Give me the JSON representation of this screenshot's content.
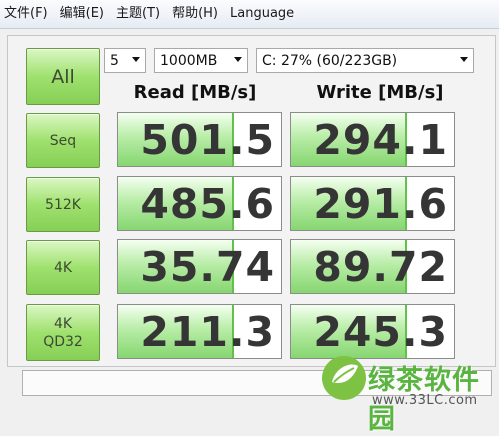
{
  "menu": [
    "文件(F)",
    "编辑(E)",
    "主题(T)",
    "帮助(H)",
    "Language"
  ],
  "controls": {
    "all_label": "All",
    "count_value": "5",
    "size_value": "1000MB",
    "drive_value": "C: 27% (60/223GB)"
  },
  "headers": {
    "read": "Read [MB/s]",
    "write": "Write [MB/s]"
  },
  "rows": [
    {
      "label": "Seq",
      "read": "501.5",
      "write": "294.1",
      "read_fill": 0.71,
      "write_fill": 0.71
    },
    {
      "label": "512K",
      "read": "485.6",
      "write": "291.6",
      "read_fill": 0.71,
      "write_fill": 0.71
    },
    {
      "label": "4K",
      "read": "35.74",
      "write": "89.72",
      "read_fill": 0.71,
      "write_fill": 0.71
    },
    {
      "label": "4K\nQD32",
      "read": "211.3",
      "write": "245.3",
      "read_fill": 0.71,
      "write_fill": 0.71
    }
  ],
  "status_text": "",
  "watermark": {
    "name": "绿茶软件园",
    "url": "www.33LC.com"
  },
  "colors": {
    "accent_green": "#86cf55",
    "value_text": "#353535"
  }
}
